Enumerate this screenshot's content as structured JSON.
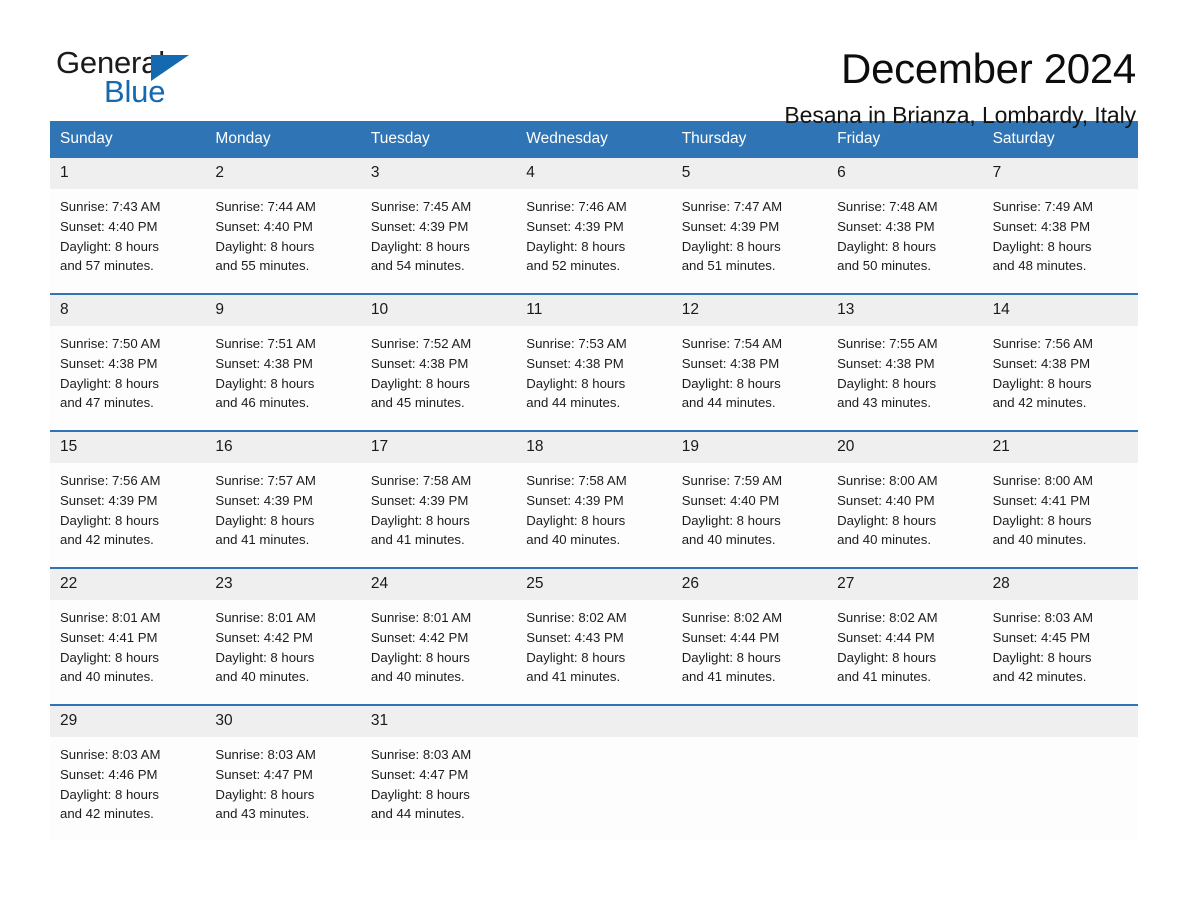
{
  "brand": {
    "name_part1": "General",
    "name_part2": "Blue",
    "triangle_color": "#1569b0"
  },
  "header": {
    "month_title": "December 2024",
    "location": "Besana in Brianza, Lombardy, Italy"
  },
  "colors": {
    "header_blue": "#2f74b5",
    "day_band_gray": "#efefef",
    "brand_blue": "#1569b0"
  },
  "calendar": {
    "weekdays": [
      "Sunday",
      "Monday",
      "Tuesday",
      "Wednesday",
      "Thursday",
      "Friday",
      "Saturday"
    ],
    "weeks": [
      [
        {
          "day": "1",
          "sunrise": "Sunrise: 7:43 AM",
          "sunset": "Sunset: 4:40 PM",
          "daylight_1": "Daylight: 8 hours",
          "daylight_2": "and 57 minutes."
        },
        {
          "day": "2",
          "sunrise": "Sunrise: 7:44 AM",
          "sunset": "Sunset: 4:40 PM",
          "daylight_1": "Daylight: 8 hours",
          "daylight_2": "and 55 minutes."
        },
        {
          "day": "3",
          "sunrise": "Sunrise: 7:45 AM",
          "sunset": "Sunset: 4:39 PM",
          "daylight_1": "Daylight: 8 hours",
          "daylight_2": "and 54 minutes."
        },
        {
          "day": "4",
          "sunrise": "Sunrise: 7:46 AM",
          "sunset": "Sunset: 4:39 PM",
          "daylight_1": "Daylight: 8 hours",
          "daylight_2": "and 52 minutes."
        },
        {
          "day": "5",
          "sunrise": "Sunrise: 7:47 AM",
          "sunset": "Sunset: 4:39 PM",
          "daylight_1": "Daylight: 8 hours",
          "daylight_2": "and 51 minutes."
        },
        {
          "day": "6",
          "sunrise": "Sunrise: 7:48 AM",
          "sunset": "Sunset: 4:38 PM",
          "daylight_1": "Daylight: 8 hours",
          "daylight_2": "and 50 minutes."
        },
        {
          "day": "7",
          "sunrise": "Sunrise: 7:49 AM",
          "sunset": "Sunset: 4:38 PM",
          "daylight_1": "Daylight: 8 hours",
          "daylight_2": "and 48 minutes."
        }
      ],
      [
        {
          "day": "8",
          "sunrise": "Sunrise: 7:50 AM",
          "sunset": "Sunset: 4:38 PM",
          "daylight_1": "Daylight: 8 hours",
          "daylight_2": "and 47 minutes."
        },
        {
          "day": "9",
          "sunrise": "Sunrise: 7:51 AM",
          "sunset": "Sunset: 4:38 PM",
          "daylight_1": "Daylight: 8 hours",
          "daylight_2": "and 46 minutes."
        },
        {
          "day": "10",
          "sunrise": "Sunrise: 7:52 AM",
          "sunset": "Sunset: 4:38 PM",
          "daylight_1": "Daylight: 8 hours",
          "daylight_2": "and 45 minutes."
        },
        {
          "day": "11",
          "sunrise": "Sunrise: 7:53 AM",
          "sunset": "Sunset: 4:38 PM",
          "daylight_1": "Daylight: 8 hours",
          "daylight_2": "and 44 minutes."
        },
        {
          "day": "12",
          "sunrise": "Sunrise: 7:54 AM",
          "sunset": "Sunset: 4:38 PM",
          "daylight_1": "Daylight: 8 hours",
          "daylight_2": "and 44 minutes."
        },
        {
          "day": "13",
          "sunrise": "Sunrise: 7:55 AM",
          "sunset": "Sunset: 4:38 PM",
          "daylight_1": "Daylight: 8 hours",
          "daylight_2": "and 43 minutes."
        },
        {
          "day": "14",
          "sunrise": "Sunrise: 7:56 AM",
          "sunset": "Sunset: 4:38 PM",
          "daylight_1": "Daylight: 8 hours",
          "daylight_2": "and 42 minutes."
        }
      ],
      [
        {
          "day": "15",
          "sunrise": "Sunrise: 7:56 AM",
          "sunset": "Sunset: 4:39 PM",
          "daylight_1": "Daylight: 8 hours",
          "daylight_2": "and 42 minutes."
        },
        {
          "day": "16",
          "sunrise": "Sunrise: 7:57 AM",
          "sunset": "Sunset: 4:39 PM",
          "daylight_1": "Daylight: 8 hours",
          "daylight_2": "and 41 minutes."
        },
        {
          "day": "17",
          "sunrise": "Sunrise: 7:58 AM",
          "sunset": "Sunset: 4:39 PM",
          "daylight_1": "Daylight: 8 hours",
          "daylight_2": "and 41 minutes."
        },
        {
          "day": "18",
          "sunrise": "Sunrise: 7:58 AM",
          "sunset": "Sunset: 4:39 PM",
          "daylight_1": "Daylight: 8 hours",
          "daylight_2": "and 40 minutes."
        },
        {
          "day": "19",
          "sunrise": "Sunrise: 7:59 AM",
          "sunset": "Sunset: 4:40 PM",
          "daylight_1": "Daylight: 8 hours",
          "daylight_2": "and 40 minutes."
        },
        {
          "day": "20",
          "sunrise": "Sunrise: 8:00 AM",
          "sunset": "Sunset: 4:40 PM",
          "daylight_1": "Daylight: 8 hours",
          "daylight_2": "and 40 minutes."
        },
        {
          "day": "21",
          "sunrise": "Sunrise: 8:00 AM",
          "sunset": "Sunset: 4:41 PM",
          "daylight_1": "Daylight: 8 hours",
          "daylight_2": "and 40 minutes."
        }
      ],
      [
        {
          "day": "22",
          "sunrise": "Sunrise: 8:01 AM",
          "sunset": "Sunset: 4:41 PM",
          "daylight_1": "Daylight: 8 hours",
          "daylight_2": "and 40 minutes."
        },
        {
          "day": "23",
          "sunrise": "Sunrise: 8:01 AM",
          "sunset": "Sunset: 4:42 PM",
          "daylight_1": "Daylight: 8 hours",
          "daylight_2": "and 40 minutes."
        },
        {
          "day": "24",
          "sunrise": "Sunrise: 8:01 AM",
          "sunset": "Sunset: 4:42 PM",
          "daylight_1": "Daylight: 8 hours",
          "daylight_2": "and 40 minutes."
        },
        {
          "day": "25",
          "sunrise": "Sunrise: 8:02 AM",
          "sunset": "Sunset: 4:43 PM",
          "daylight_1": "Daylight: 8 hours",
          "daylight_2": "and 41 minutes."
        },
        {
          "day": "26",
          "sunrise": "Sunrise: 8:02 AM",
          "sunset": "Sunset: 4:44 PM",
          "daylight_1": "Daylight: 8 hours",
          "daylight_2": "and 41 minutes."
        },
        {
          "day": "27",
          "sunrise": "Sunrise: 8:02 AM",
          "sunset": "Sunset: 4:44 PM",
          "daylight_1": "Daylight: 8 hours",
          "daylight_2": "and 41 minutes."
        },
        {
          "day": "28",
          "sunrise": "Sunrise: 8:03 AM",
          "sunset": "Sunset: 4:45 PM",
          "daylight_1": "Daylight: 8 hours",
          "daylight_2": "and 42 minutes."
        }
      ],
      [
        {
          "day": "29",
          "sunrise": "Sunrise: 8:03 AM",
          "sunset": "Sunset: 4:46 PM",
          "daylight_1": "Daylight: 8 hours",
          "daylight_2": "and 42 minutes."
        },
        {
          "day": "30",
          "sunrise": "Sunrise: 8:03 AM",
          "sunset": "Sunset: 4:47 PM",
          "daylight_1": "Daylight: 8 hours",
          "daylight_2": "and 43 minutes."
        },
        {
          "day": "31",
          "sunrise": "Sunrise: 8:03 AM",
          "sunset": "Sunset: 4:47 PM",
          "daylight_1": "Daylight: 8 hours",
          "daylight_2": "and 44 minutes."
        },
        {
          "day": "",
          "sunrise": "",
          "sunset": "",
          "daylight_1": "",
          "daylight_2": ""
        },
        {
          "day": "",
          "sunrise": "",
          "sunset": "",
          "daylight_1": "",
          "daylight_2": ""
        },
        {
          "day": "",
          "sunrise": "",
          "sunset": "",
          "daylight_1": "",
          "daylight_2": ""
        },
        {
          "day": "",
          "sunrise": "",
          "sunset": "",
          "daylight_1": "",
          "daylight_2": ""
        }
      ]
    ]
  }
}
